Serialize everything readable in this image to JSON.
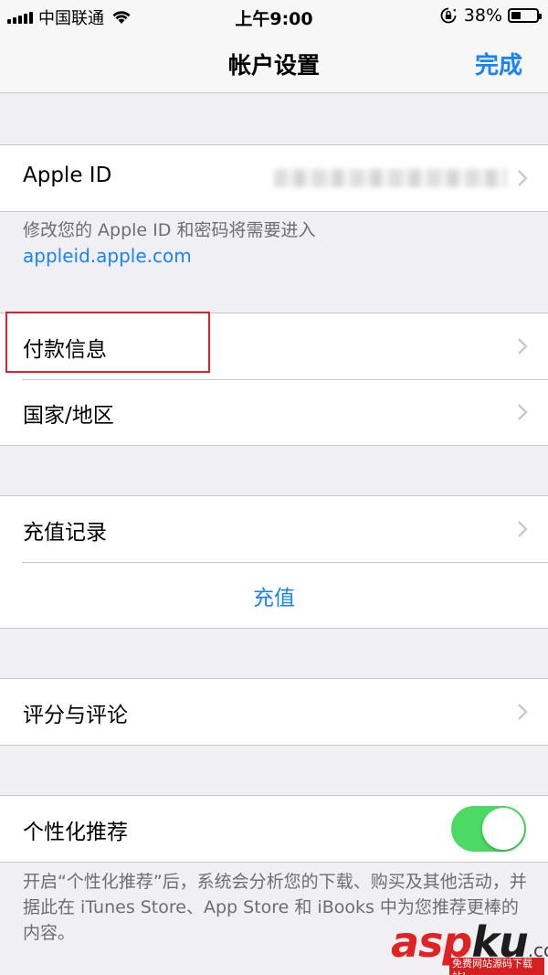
{
  "status_bar": {
    "carrier": "中国联通",
    "time": "上午9:00",
    "battery": "38%",
    "battery_level": 0.38
  },
  "nav": {
    "title": "帐户设置",
    "done_label": "完成"
  },
  "apple_id_group": {
    "label": "Apple ID"
  },
  "apple_id_footer": {
    "text": "修改您的 Apple ID 和密码将需要进入",
    "link": "appleid.apple.com"
  },
  "payment_group": {
    "items": [
      {
        "label": "付款信息"
      },
      {
        "label": "国家/地区"
      }
    ]
  },
  "recharge_group": {
    "history_label": "充值记录",
    "recharge_label": "充值"
  },
  "ratings_group": {
    "label": "评分与评论"
  },
  "personalized_group": {
    "label": "个性化推荐",
    "toggle_on": true,
    "footer": "开启“个性化推荐”后，系统会分析您的下载、购买及其他活动，并据此在 iTunes Store、App Store 和 iBooks 中为您推荐更棒的内容。"
  },
  "colors": {
    "accent": "#1a82fb",
    "toggle_on": "#4cd964",
    "highlight": "#e0202a",
    "background": "#efeff4"
  },
  "watermark": {
    "brand_a": "asp",
    "brand_b": "ku",
    "suffix": ".com",
    "tagline": "免费网站源码下载站!"
  }
}
